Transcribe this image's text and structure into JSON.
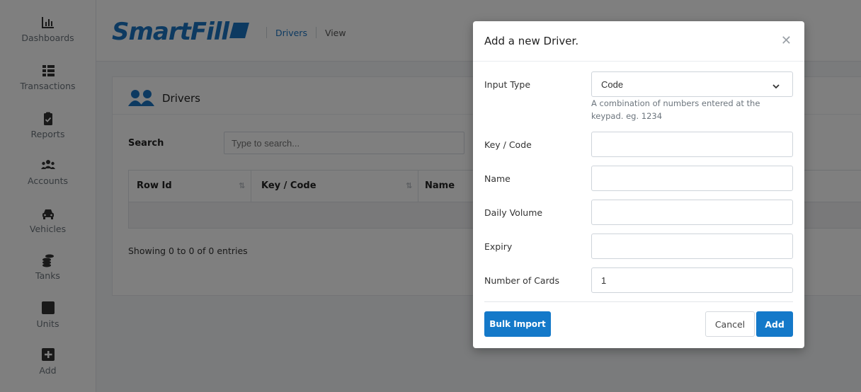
{
  "sidebar": {
    "items": [
      {
        "label": "Dashboards",
        "icon": "chart-icon"
      },
      {
        "label": "Transactions",
        "icon": "list-icon"
      },
      {
        "label": "Reports",
        "icon": "clipboard-check-icon"
      },
      {
        "label": "Accounts",
        "icon": "users-icon"
      },
      {
        "label": "Vehicles",
        "icon": "car-icon"
      },
      {
        "label": "Tanks",
        "icon": "coins-icon"
      },
      {
        "label": "Units",
        "icon": "square-icon"
      },
      {
        "label": "Add",
        "icon": "plus-square-icon"
      }
    ]
  },
  "header": {
    "logo": "SmartFill",
    "breadcrumb": [
      "Drivers",
      "View"
    ]
  },
  "page": {
    "title": "Drivers",
    "search_label": "Search",
    "search_placeholder": "Type to search...",
    "table_headers": [
      "Row Id",
      "Key / Code",
      "Name"
    ],
    "info": "Showing 0 to 0 of 0 entries"
  },
  "modal": {
    "title": "Add a new Driver.",
    "fields": {
      "input_type_label": "Input Type",
      "input_type_value": "Code",
      "input_type_help": "A combination of numbers entered at the keypad. eg. 1234",
      "key_code_label": "Key / Code",
      "key_code_value": "",
      "name_label": "Name",
      "name_value": "",
      "daily_volume_label": "Daily Volume",
      "daily_volume_value": "",
      "expiry_label": "Expiry",
      "expiry_value": "",
      "number_of_cards_label": "Number of Cards",
      "number_of_cards_value": "1"
    },
    "buttons": {
      "bulk_import": "Bulk Import",
      "cancel": "Cancel",
      "add": "Add"
    }
  },
  "colors": {
    "brand": "#1b74c2",
    "primary_button": "#1479c9",
    "overlay": "rgba(0,0,0,0.5)"
  }
}
